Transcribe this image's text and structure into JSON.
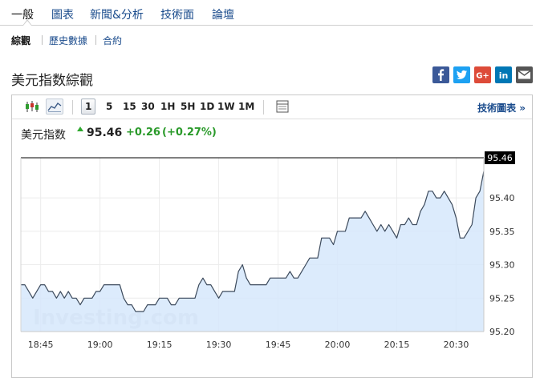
{
  "nav": {
    "tabs": [
      {
        "label": "一般",
        "active": true
      },
      {
        "label": "圖表",
        "active": false
      },
      {
        "label": "新聞&分析",
        "active": false
      },
      {
        "label": "技術面",
        "active": false
      },
      {
        "label": "論壇",
        "active": false
      }
    ]
  },
  "subnav": {
    "items": [
      {
        "label": "綜觀",
        "active": true
      },
      {
        "label": "歷史數據",
        "active": false
      },
      {
        "label": "合約",
        "active": false
      }
    ]
  },
  "page": {
    "title": "美元指数綜觀"
  },
  "share": [
    {
      "name": "facebook",
      "glyph": "f",
      "color": "#3b5998"
    },
    {
      "name": "twitter",
      "glyph": "twitter-bird",
      "color": "#1da1f2"
    },
    {
      "name": "google-plus",
      "glyph": "G+",
      "color": "#dd4b39"
    },
    {
      "name": "linkedin",
      "glyph": "in",
      "color": "#0077b5"
    },
    {
      "name": "email",
      "glyph": "envelope",
      "color": "#555555"
    }
  ],
  "toolbar": {
    "ranges": [
      "1",
      "5",
      "15",
      "30",
      "1H",
      "5H",
      "1D",
      "1W",
      "1M"
    ],
    "selected_range": "1",
    "tech_chart_link": "技術圖表 »"
  },
  "quote": {
    "name": "美元指数",
    "price": "95.46",
    "change": "+0.26",
    "change_pct": "(+0.27%)"
  },
  "chart_data": {
    "type": "area",
    "x": [
      "18:40",
      "18:41",
      "18:42",
      "18:43",
      "18:44",
      "18:45",
      "18:46",
      "18:47",
      "18:48",
      "18:49",
      "18:50",
      "18:51",
      "18:52",
      "18:53",
      "18:54",
      "18:55",
      "18:56",
      "18:57",
      "18:58",
      "18:59",
      "19:00",
      "19:01",
      "19:02",
      "19:03",
      "19:04",
      "19:05",
      "19:06",
      "19:07",
      "19:08",
      "19:09",
      "19:10",
      "19:11",
      "19:12",
      "19:13",
      "19:14",
      "19:15",
      "19:16",
      "19:17",
      "19:18",
      "19:19",
      "19:20",
      "19:21",
      "19:22",
      "19:23",
      "19:24",
      "19:25",
      "19:26",
      "19:27",
      "19:28",
      "19:29",
      "19:30",
      "19:31",
      "19:32",
      "19:33",
      "19:34",
      "19:35",
      "19:36",
      "19:37",
      "19:38",
      "19:39",
      "19:40",
      "19:41",
      "19:42",
      "19:43",
      "19:44",
      "19:45",
      "19:46",
      "19:47",
      "19:48",
      "19:49",
      "19:50",
      "19:51",
      "19:52",
      "19:53",
      "19:54",
      "19:55",
      "19:56",
      "19:57",
      "19:58",
      "19:59",
      "20:00",
      "20:01",
      "20:02",
      "20:03",
      "20:04",
      "20:05",
      "20:06",
      "20:07",
      "20:08",
      "20:09",
      "20:10",
      "20:11",
      "20:12",
      "20:13",
      "20:14",
      "20:15",
      "20:16",
      "20:17",
      "20:18",
      "20:19",
      "20:20",
      "20:21",
      "20:22",
      "20:23",
      "20:24",
      "20:25",
      "20:26",
      "20:27",
      "20:28",
      "20:29",
      "20:30",
      "20:31",
      "20:32",
      "20:33",
      "20:34",
      "20:35",
      "20:36",
      "20:37"
    ],
    "y": [
      95.27,
      95.27,
      95.26,
      95.25,
      95.26,
      95.27,
      95.27,
      95.26,
      95.26,
      95.25,
      95.26,
      95.25,
      95.26,
      95.25,
      95.25,
      95.24,
      95.25,
      95.25,
      95.25,
      95.26,
      95.26,
      95.27,
      95.27,
      95.27,
      95.27,
      95.27,
      95.25,
      95.24,
      95.24,
      95.23,
      95.23,
      95.23,
      95.24,
      95.24,
      95.24,
      95.25,
      95.25,
      95.25,
      95.24,
      95.24,
      95.25,
      95.25,
      95.25,
      95.25,
      95.25,
      95.27,
      95.28,
      95.27,
      95.27,
      95.26,
      95.25,
      95.26,
      95.26,
      95.26,
      95.26,
      95.29,
      95.3,
      95.28,
      95.27,
      95.27,
      95.27,
      95.27,
      95.27,
      95.28,
      95.28,
      95.28,
      95.28,
      95.28,
      95.29,
      95.28,
      95.28,
      95.29,
      95.3,
      95.31,
      95.31,
      95.31,
      95.34,
      95.34,
      95.34,
      95.33,
      95.35,
      95.35,
      95.35,
      95.37,
      95.37,
      95.37,
      95.37,
      95.38,
      95.37,
      95.36,
      95.35,
      95.36,
      95.35,
      95.36,
      95.35,
      95.34,
      95.36,
      95.36,
      95.37,
      95.36,
      95.36,
      95.38,
      95.39,
      95.41,
      95.41,
      95.4,
      95.4,
      95.41,
      95.4,
      95.39,
      95.37,
      95.34,
      95.34,
      95.35,
      95.36,
      95.4,
      95.41,
      95.44,
      95.45,
      95.46
    ],
    "last_value": "95.46",
    "x_ticks": [
      "18:45",
      "19:00",
      "19:15",
      "19:30",
      "19:45",
      "20:00",
      "20:15",
      "20:30"
    ],
    "y_ticks": [
      "95.20",
      "95.25",
      "95.30",
      "95.35",
      "95.40"
    ],
    "ylim": [
      95.2,
      95.46
    ],
    "grid": true,
    "line_color": "#3c4a5c",
    "fill_color": "#d6e8fb",
    "watermark": "Investing.com"
  }
}
